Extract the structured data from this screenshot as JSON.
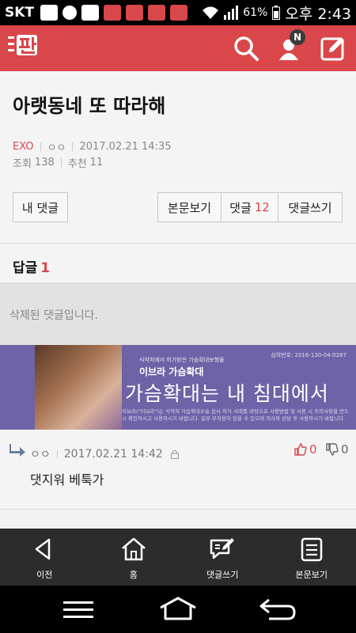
{
  "status_bar": {
    "carrier": "SKT",
    "battery": "61%",
    "time": "오후 2:43",
    "notification_badge": "N"
  },
  "header": {
    "logo_text": "판",
    "accent_color": "#d9474a"
  },
  "post": {
    "title": "아랫동네 또 따라해",
    "category": "EXO",
    "author": "ㅇㅇ",
    "datetime": "2017.02.21 14:35",
    "views_label": "조회",
    "views": "138",
    "recommend_label": "추천",
    "recommends": "11"
  },
  "actions": {
    "my_comments": "내 댓글",
    "view_post": "본문보기",
    "comments_label": "댓글",
    "comments_count": "12",
    "write_comment": "댓글쓰기"
  },
  "replies": {
    "label": "답글",
    "count": "1",
    "deleted_text": "삭제된 댓글입니다."
  },
  "ad": {
    "brand_small": "식약처에서 허가받은 가슴확대보형물",
    "brand": "이브라 가슴확대",
    "permit": "심의번호: 2016-130-04-0287",
    "slogan": "가슴확대는 내 침대에서",
    "fine_print": "이브라(\"이브라\")는 식약처 가슴확대수술 심사 허가 사례를 바탕으로 사용방법 및 사용 시 주의사항을 반드시 확인하시고 사용하시기 바랍니다. 일부 부작용이 있을 수 있으며 의사와 상담 후 사용하시기 바랍니다."
  },
  "comment": {
    "author": "ㅇㅇ",
    "datetime": "2017.02.21 14:42",
    "body": "댓지워 베툭가",
    "upvotes": "0",
    "downvotes": "0"
  },
  "bottom_nav": [
    {
      "label": "이전",
      "icon": "back-triangle-icon"
    },
    {
      "label": "홈",
      "icon": "home-icon"
    },
    {
      "label": "댓글쓰기",
      "icon": "comment-write-icon"
    },
    {
      "label": "본문보기",
      "icon": "document-icon"
    }
  ]
}
